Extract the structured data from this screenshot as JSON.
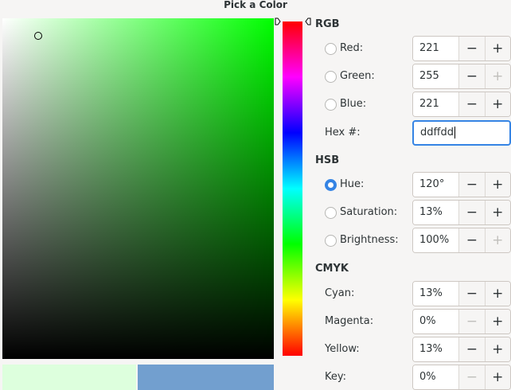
{
  "window": {
    "title": "Pick a Color"
  },
  "swatches": {
    "new_color": "#ddffdd",
    "old_color": "#729fcf"
  },
  "rgb": {
    "title": "RGB",
    "red": {
      "label": "Red:",
      "value": "221",
      "selected": false
    },
    "green": {
      "label": "Green:",
      "value": "255",
      "selected": false
    },
    "blue": {
      "label": "Blue:",
      "value": "221",
      "selected": false
    },
    "hex": {
      "label": "Hex #:",
      "value": "ddffdd"
    }
  },
  "hsb": {
    "title": "HSB",
    "hue": {
      "label": "Hue:",
      "value": "120°",
      "selected": true
    },
    "saturation": {
      "label": "Saturation:",
      "value": "13%",
      "selected": false
    },
    "brightness": {
      "label": "Brightness:",
      "value": "100%",
      "selected": false
    }
  },
  "cmyk": {
    "title": "CMYK",
    "cyan": {
      "label": "Cyan:",
      "value": "13%"
    },
    "magenta": {
      "label": "Magenta:",
      "value": "0%"
    },
    "yellow": {
      "label": "Yellow:",
      "value": "13%"
    },
    "key": {
      "label": "Key:",
      "value": "0%"
    }
  },
  "buttons": {
    "minus": "−",
    "plus": "+"
  },
  "colors": {
    "accent": "#3584e4",
    "selected_hue": "#00ff00"
  }
}
